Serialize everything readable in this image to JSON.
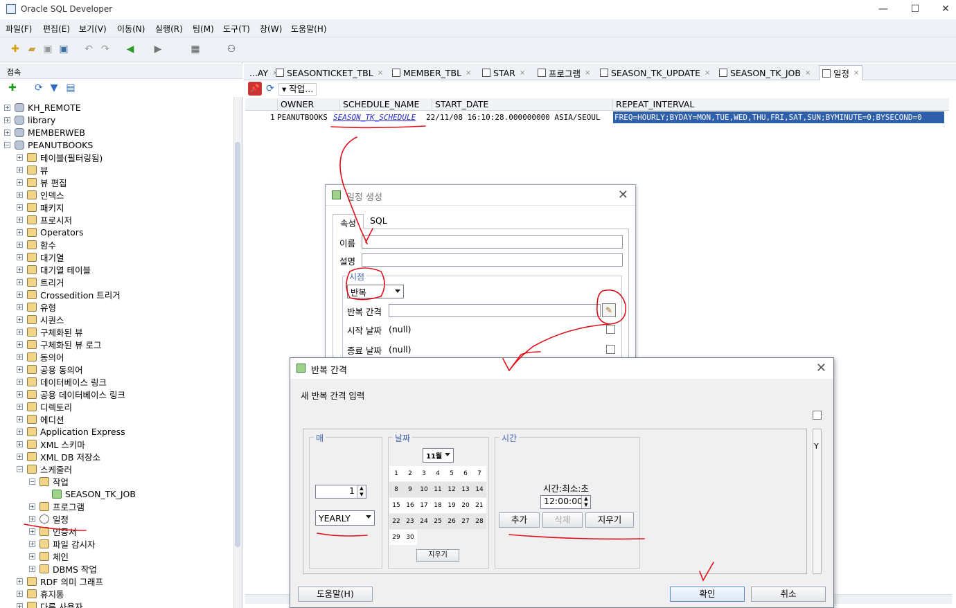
{
  "window": {
    "title": "Oracle SQL Developer",
    "controls": [
      "—",
      "☐",
      "✕"
    ]
  },
  "menu": [
    "파일(F)",
    "편집(E)",
    "보기(V)",
    "이동(N)",
    "실행(R)",
    "팀(M)",
    "도구(T)",
    "창(W)",
    "도움말(H)"
  ],
  "left_panel": {
    "header": "접속",
    "tree": [
      {
        "label": "KH_REMOTE",
        "level": 0,
        "icon": "db"
      },
      {
        "label": "library",
        "level": 0,
        "icon": "db"
      },
      {
        "label": "MEMBERWEB",
        "level": 0,
        "icon": "db"
      },
      {
        "label": "PEANUTBOOKS",
        "level": 0,
        "icon": "db",
        "expanded": true
      },
      {
        "label": "테이블(필터링됨)",
        "level": 1
      },
      {
        "label": "뷰",
        "level": 1
      },
      {
        "label": "뷰 편집",
        "level": 1
      },
      {
        "label": "인덱스",
        "level": 1
      },
      {
        "label": "패키지",
        "level": 1
      },
      {
        "label": "프로시저",
        "level": 1
      },
      {
        "label": "Operators",
        "level": 1
      },
      {
        "label": "함수",
        "level": 1
      },
      {
        "label": "대기열",
        "level": 1
      },
      {
        "label": "대기열 테이블",
        "level": 1
      },
      {
        "label": "트리거",
        "level": 1
      },
      {
        "label": "Crossedition 트리거",
        "level": 1
      },
      {
        "label": "유형",
        "level": 1
      },
      {
        "label": "시퀀스",
        "level": 1
      },
      {
        "label": "구체화된 뷰",
        "level": 1
      },
      {
        "label": "구체화된 뷰 로그",
        "level": 1
      },
      {
        "label": "동의어",
        "level": 1
      },
      {
        "label": "공용 동의어",
        "level": 1
      },
      {
        "label": "데이터베이스 링크",
        "level": 1
      },
      {
        "label": "공용 데이터베이스 링크",
        "level": 1
      },
      {
        "label": "디렉토리",
        "level": 1
      },
      {
        "label": "에디션",
        "level": 1
      },
      {
        "label": "Application Express",
        "level": 1
      },
      {
        "label": "XML 스키마",
        "level": 1
      },
      {
        "label": "XML DB 저장소",
        "level": 1
      },
      {
        "label": "스케줄러",
        "level": 1,
        "expanded": true
      },
      {
        "label": "작업",
        "level": 2,
        "expanded": true
      },
      {
        "label": "SEASON_TK_JOB",
        "level": 3,
        "icon": "grn"
      },
      {
        "label": "프로그램",
        "level": 2
      },
      {
        "label": "일정",
        "level": 2,
        "icon": "clk"
      },
      {
        "label": "인증서",
        "level": 2
      },
      {
        "label": "파일 감시자",
        "level": 2
      },
      {
        "label": "체인",
        "level": 2
      },
      {
        "label": "DBMS 작업",
        "level": 2
      },
      {
        "label": "RDF 의미 그래프",
        "level": 1
      },
      {
        "label": "휴지통",
        "level": 1
      },
      {
        "label": "다른 사용자",
        "level": 1
      }
    ]
  },
  "tabs": [
    {
      "label": "...AY",
      "icon": false
    },
    {
      "label": "SEASONTICKET_TBL",
      "icon": true
    },
    {
      "label": "MEMBER_TBL",
      "icon": true
    },
    {
      "label": "STAR",
      "icon": true
    },
    {
      "label": "프로그램",
      "icon": true
    },
    {
      "label": "SEASON_TK_UPDATE",
      "icon": true
    },
    {
      "label": "SEASON_TK_JOB",
      "icon": true
    },
    {
      "label": "일정",
      "icon": true,
      "active": true
    }
  ],
  "editor_toolbar": {
    "actions_label": "▾ 작업..."
  },
  "grid": {
    "columns": [
      "OWNER",
      "SCHEDULE_NAME",
      "START_DATE",
      "REPEAT_INTERVAL"
    ],
    "row": {
      "num": "1",
      "owner": "PEANUTBOOKS",
      "schedule_name": "SEASON_TK_SCHEDULE",
      "start_date": "22/11/08 16:10:28.000000000 ASIA/SEOUL",
      "repeat_interval": "FREQ=HOURLY;BYDAY=MON,TUE,WED,THU,FRI,SAT,SUN;BYMINUTE=0;BYSECOND=0"
    }
  },
  "dialog_create": {
    "title": "일정 생성",
    "tabs": [
      "속성",
      "SQL"
    ],
    "name_label": "이름",
    "desc_label": "설명",
    "group_label": "시점",
    "timing_value": "반복",
    "interval_label": "반복 간격",
    "start_label": "시작 날짜",
    "start_value": "(null)",
    "end_label": "종료 날짜",
    "end_value": "(null)"
  },
  "dialog_interval": {
    "title": "반복 간격",
    "subtitle": "새 반복 간격 입력",
    "every_group": "매",
    "every_count": "1",
    "frequency": "YEARLY",
    "date_group": "날짜",
    "month": "11월",
    "days": [
      "1",
      "2",
      "3",
      "4",
      "5",
      "6",
      "7",
      "8",
      "9",
      "10",
      "11",
      "12",
      "13",
      "14",
      "15",
      "16",
      "17",
      "18",
      "19",
      "20",
      "21",
      "22",
      "23",
      "24",
      "25",
      "26",
      "27",
      "28",
      "29",
      "30"
    ],
    "clear_date": "지우기",
    "time_group": "시간",
    "time_label": "시간:최소:초",
    "time_value": "12:00:00",
    "add_btn": "추가",
    "delete_btn": "삭제",
    "clear_btn": "지우기",
    "side_text": "Y",
    "help_btn": "도움말(H)",
    "ok_btn": "확인",
    "cancel_btn": "취소"
  },
  "colors": {
    "selection": "#2e5fa8",
    "annotation": "#e0101a",
    "link": "#2a2ad8"
  }
}
